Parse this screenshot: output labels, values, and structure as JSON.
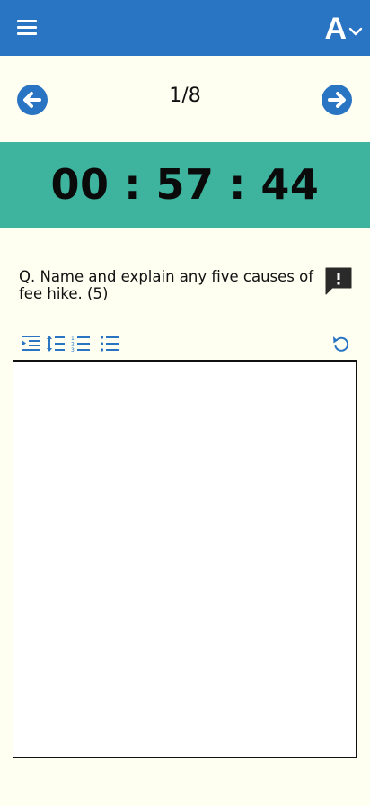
{
  "header": {
    "font_switch_label": "A",
    "menu_icon": "hamburger-icon",
    "accent_color": "#2a74c4"
  },
  "navigation": {
    "counter": "1/8",
    "prev_icon": "arrow-left-circle-icon",
    "next_icon": "arrow-right-circle-icon"
  },
  "timer": {
    "value": "00 : 57 : 44",
    "background_color": "#3eb39d"
  },
  "question": {
    "text": "Q.  Name and explain any five causes of fee hike. (5)",
    "report_icon": "report-flag-icon"
  },
  "editor": {
    "tools": [
      "indent-icon",
      "line-spacing-icon",
      "numbered-list-icon",
      "bullet-list-icon"
    ],
    "undo_icon": "undo-icon",
    "answer_value": ""
  }
}
